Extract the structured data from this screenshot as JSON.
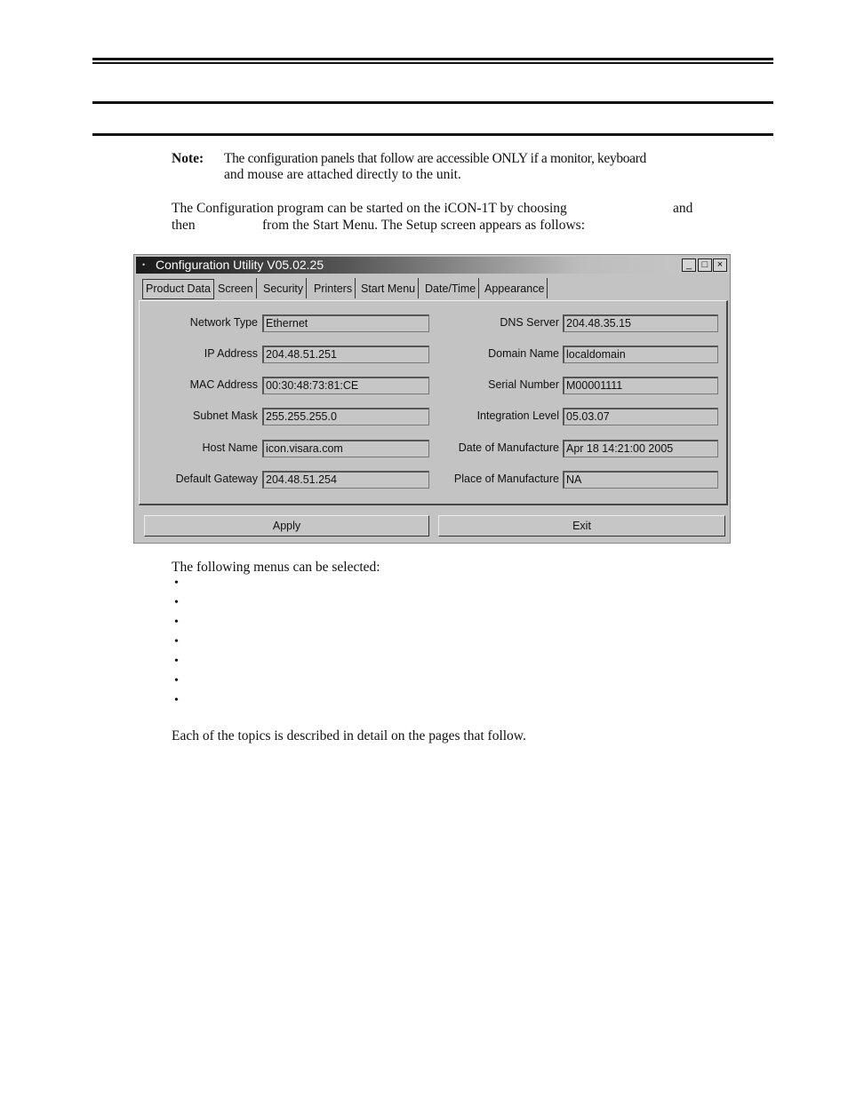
{
  "doc": {
    "note_label": "Note:",
    "note_line1": "The configuration panels that follow are accessible ONLY if a monitor, keyboard",
    "note_line2": "and mouse are attached directly to the unit.",
    "intro_line1_a": "The Configuration program can be started on the iCON-1T by choosing",
    "intro_line1_b": "and",
    "intro_line2_a": "then",
    "intro_line2_b": "from the Start Menu. The Setup screen appears as follows:",
    "menus_intro": "The following menus can be selected:",
    "bullets": [
      "•",
      "•",
      "•",
      "•",
      "•",
      "•",
      "•"
    ],
    "closing": "Each of the topics is described in detail on the pages that follow."
  },
  "window": {
    "title": "Configuration Utility V05.02.25",
    "menu_icon": "•",
    "minimize": "_",
    "maximize": "□",
    "close": "×",
    "tabs": [
      "Product Data",
      "Screen",
      "Security",
      "Printers",
      "Start Menu",
      "Date/Time",
      "Appearance"
    ],
    "active_tab": "Product Data",
    "left_fields": [
      {
        "label": "Network Type",
        "value": "Ethernet"
      },
      {
        "label": "IP Address",
        "value": "204.48.51.251"
      },
      {
        "label": "MAC Address",
        "value": "00:30:48:73:81:CE"
      },
      {
        "label": "Subnet Mask",
        "value": "255.255.255.0"
      },
      {
        "label": "Host Name",
        "value": "icon.visara.com"
      },
      {
        "label": "Default Gateway",
        "value": "204.48.51.254"
      }
    ],
    "right_fields": [
      {
        "label": "DNS Server",
        "value": "204.48.35.15"
      },
      {
        "label": "Domain Name",
        "value": "localdomain"
      },
      {
        "label": "Serial Number",
        "value": "M00001111"
      },
      {
        "label": "Integration Level",
        "value": "05.03.07"
      },
      {
        "label": "Date of Manufacture",
        "value": "Apr 18 14:21:00 2005"
      },
      {
        "label": "Place of Manufacture",
        "value": "NA"
      }
    ],
    "apply_label": "Apply",
    "exit_label": "Exit"
  }
}
